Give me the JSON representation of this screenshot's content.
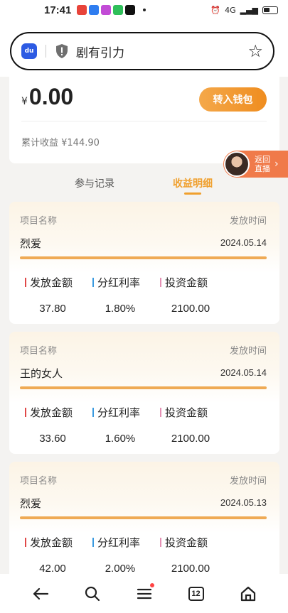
{
  "status_bar": {
    "time": "17:41",
    "network": "4G"
  },
  "browser": {
    "page_title": "剧有引力",
    "logo_text": "du"
  },
  "wallet": {
    "currency": "¥",
    "balance": "0.00",
    "transfer_button": "转入钱包",
    "cumulative_earnings": "累计收益 ¥144.90"
  },
  "live_float": {
    "label_line1": "返回",
    "label_line2": "直播"
  },
  "tabs": [
    {
      "label": "参与记录",
      "active": false
    },
    {
      "label": "收益明细",
      "active": true
    }
  ],
  "labels": {
    "project_name": "项目名称",
    "release_time": "发放时间",
    "release_amount": "发放金额",
    "dividend_rate": "分红利率",
    "investment_amount": "投资金额"
  },
  "records": [
    {
      "name": "烈爱",
      "date": "2024.05.14",
      "release_amount": "37.80",
      "dividend_rate": "1.80%",
      "investment_amount": "2100.00"
    },
    {
      "name": "王的女人",
      "date": "2024.05.14",
      "release_amount": "33.60",
      "dividend_rate": "1.60%",
      "investment_amount": "2100.00"
    },
    {
      "name": "烈爱",
      "date": "2024.05.13",
      "release_amount": "42.00",
      "dividend_rate": "2.00%",
      "investment_amount": "2100.00"
    }
  ],
  "bottom_nav": {
    "tab_count": "12"
  },
  "colors": {
    "accent": "#f0a02e",
    "marker_red": "#e04848",
    "marker_blue": "#3a9ae0",
    "marker_pink": "#e590b4"
  }
}
